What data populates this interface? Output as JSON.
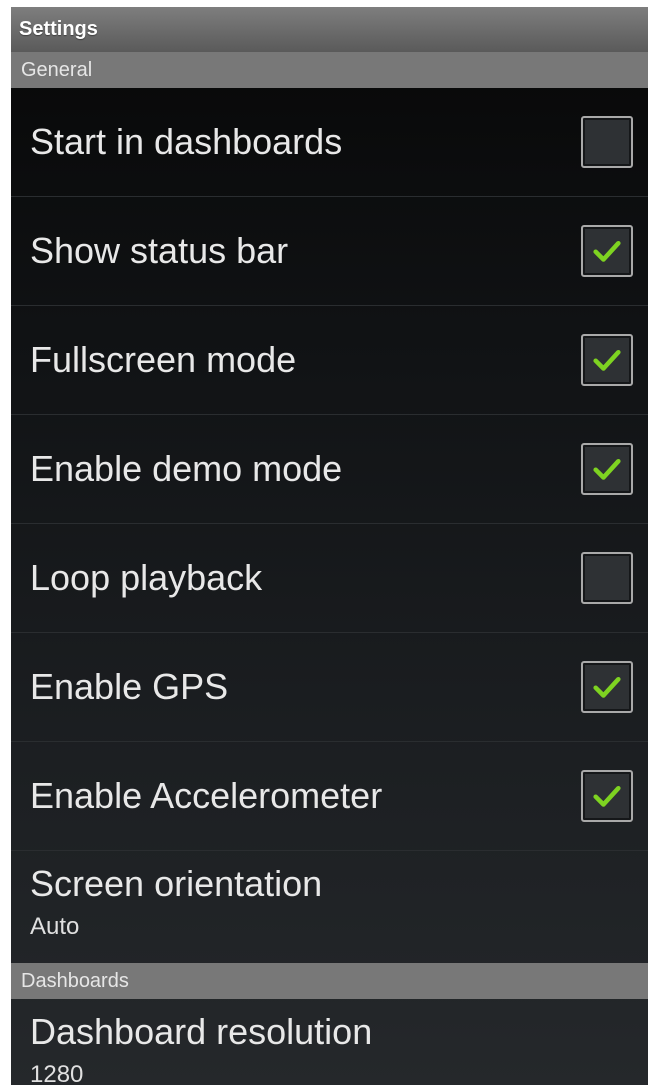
{
  "title_bar": {
    "title": "Settings"
  },
  "sections": [
    {
      "header": "General",
      "checkbox_items": [
        {
          "label": "Start in dashboards",
          "checked": false
        },
        {
          "label": "Show status bar",
          "checked": true
        },
        {
          "label": "Fullscreen mode",
          "checked": true
        },
        {
          "label": "Enable demo mode",
          "checked": true
        },
        {
          "label": "Loop playback",
          "checked": false
        },
        {
          "label": "Enable GPS",
          "checked": true
        },
        {
          "label": "Enable Accelerometer",
          "checked": true
        }
      ],
      "list_item": {
        "title": "Screen orientation",
        "summary": "Auto"
      }
    },
    {
      "header": "Dashboards",
      "list_item": {
        "title": "Dashboard resolution",
        "summary": "1280"
      }
    }
  ],
  "colors": {
    "check_mark": "#7ed321",
    "section_header_bg": "#787878",
    "title_bar_bg": "#6e6e6e"
  },
  "icons": {
    "check": "check-icon"
  }
}
